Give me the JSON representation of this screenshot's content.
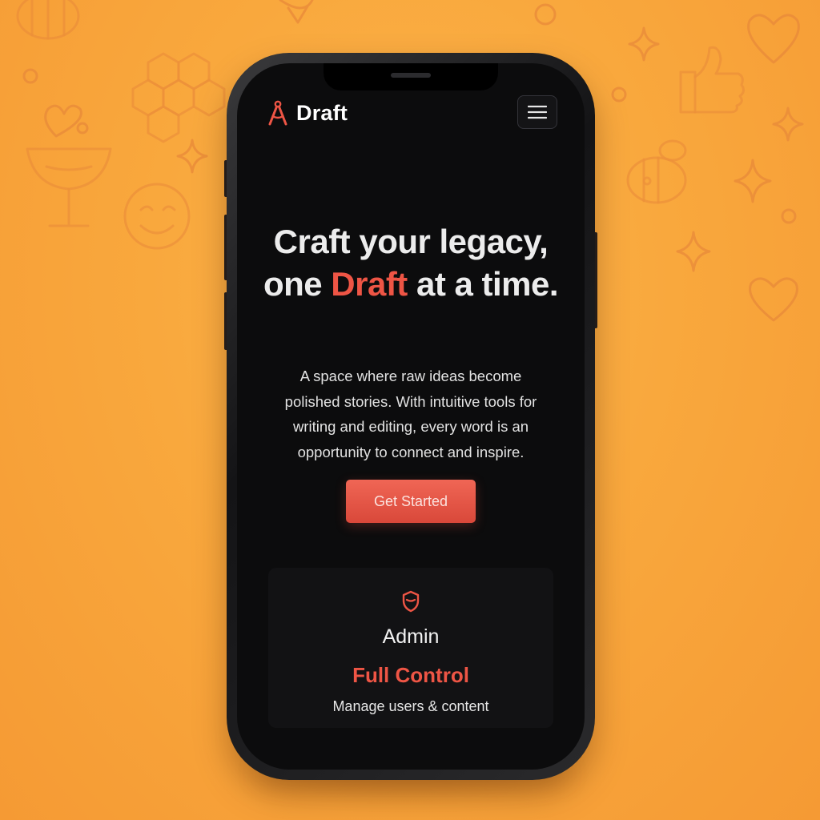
{
  "app": {
    "name": "Draft",
    "logo_icon": "compass-icon",
    "menu_icon": "hamburger-menu-icon"
  },
  "hero": {
    "headline_part1": "Craft your legacy, one ",
    "headline_accent": "Draft",
    "headline_part2": " at a time.",
    "description": "A space where raw ideas become polished stories. With intuitive tools for writing and editing, every word is an opportunity to connect and inspire.",
    "cta_label": "Get Started"
  },
  "feature_card": {
    "icon": "shield-icon",
    "role": "Admin",
    "title": "Full Control",
    "description": "Manage users & content"
  },
  "colors": {
    "accent": "#ee5545",
    "background": "#f9a83d",
    "screen": "#0c0c0d",
    "text": "#ececec"
  }
}
